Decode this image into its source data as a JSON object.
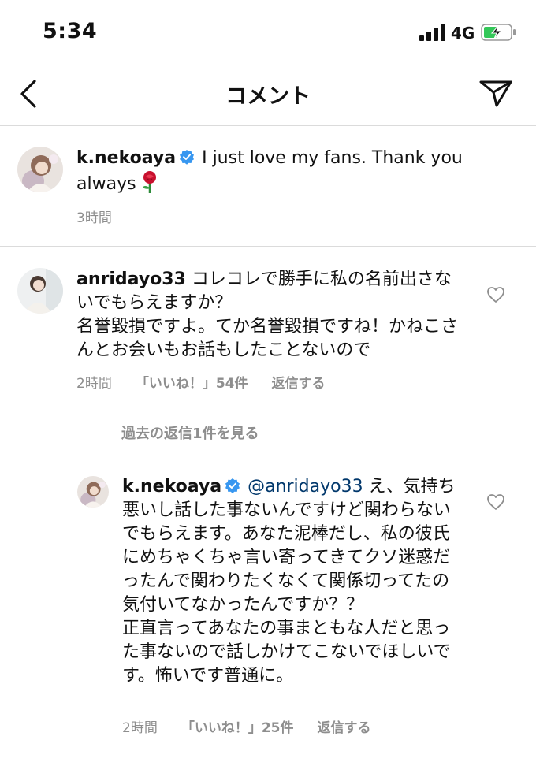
{
  "status_bar": {
    "time": "5:34",
    "network": "4G"
  },
  "header": {
    "title": "コメント"
  },
  "caption": {
    "username": "k.nekoaya",
    "text": " I just love my fans. Thank you always",
    "time": "3時間"
  },
  "comment": {
    "username": "anridayo33",
    "text": " コレコレで勝手に私の名前出さないでもらえますか？",
    "text2": "名誉毀損ですよ。てか名誉毀損ですね！かねこさんとお会いもお話もしたことないので",
    "time": "2時間",
    "likes": "「いいね！」54件",
    "reply": "返信する"
  },
  "view_replies": "過去の返信1件を見る",
  "reply": {
    "username": "k.nekoaya",
    "mention": " @anridayo33",
    "text": " え、気持ち悪いし話した事ないんですけど関わらないでもらえます。あなた泥棒だし、私の彼氏にめちゃくちゃ言い寄ってきてクソ迷惑だったんで関わりたくなくて関係切ってたの気付いてなかったんですか？？",
    "text2": "正直言ってあなたの事まともな人だと思った事ないので話しかけてこないでほしいです。怖いです普通に。",
    "time": "2時間",
    "likes": "「いいね！」25件",
    "reply": "返信する"
  }
}
